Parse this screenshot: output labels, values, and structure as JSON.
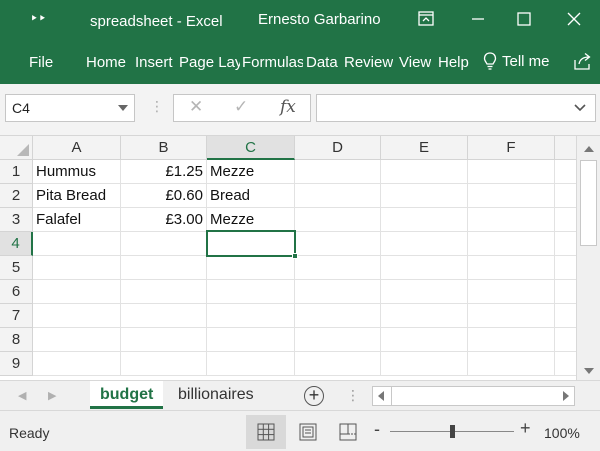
{
  "titlebar": {
    "qat_glyph": "‣‣",
    "title": "spreadsheet  -  Excel",
    "user": "Ernesto Garbarino"
  },
  "ribbon": {
    "tabs": [
      "File",
      "Home",
      "Insert",
      "Page Layout",
      "Formulas",
      "Data",
      "Review",
      "View",
      "Help"
    ],
    "tell_me": "Tell me"
  },
  "formula_bar": {
    "name_box": "C4",
    "fx_label": "fx",
    "cancel_glyph": "✕",
    "enter_glyph": "✓",
    "dots": "⋮",
    "value": ""
  },
  "grid": {
    "columns": [
      "A",
      "B",
      "C",
      "D",
      "E",
      "F"
    ],
    "rows": [
      "1",
      "2",
      "3",
      "4",
      "5",
      "6",
      "7",
      "8",
      "9"
    ],
    "cells": [
      [
        "Hummus",
        "£1.25",
        "Mezze"
      ],
      [
        "Pita Bread",
        "£0.60",
        "Bread"
      ],
      [
        "Falafel",
        "£3.00",
        "Mezze"
      ]
    ],
    "active_column": "C",
    "active_row": "4"
  },
  "sheets": {
    "tabs": [
      "budget",
      "billionaires"
    ],
    "active": "budget",
    "add_glyph": "+",
    "dots": "⋮",
    "nav_prev": "◀",
    "nav_next": "▶"
  },
  "status": {
    "ready": "Ready",
    "zoom_minus": "-",
    "zoom_plus": "+",
    "zoom": "100%"
  },
  "colors": {
    "accent": "#217346"
  }
}
